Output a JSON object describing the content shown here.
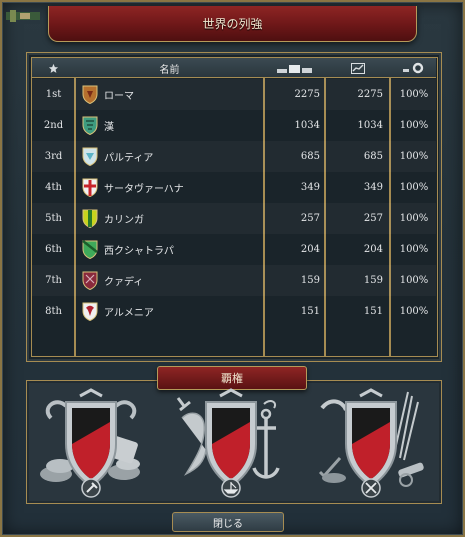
{
  "window": {
    "title": "世界の列強"
  },
  "table": {
    "headers": {
      "rank_icon": "star-icon",
      "name": "名前",
      "score_icon": "stacked-bars-icon",
      "trend_icon": "line-chart-icon",
      "percent_icon": "gear-icon"
    },
    "rows": [
      {
        "rank": "1st",
        "name": "ローマ",
        "score": "2275",
        "score2": "2275",
        "percent": "100%",
        "shield": {
          "base": "#b5702e",
          "accent": "#7a2b16"
        }
      },
      {
        "rank": "2nd",
        "name": "漢",
        "score": "1034",
        "score2": "1034",
        "percent": "100%",
        "shield": {
          "base": "#3e9c7f",
          "accent": "#1e4e3e"
        }
      },
      {
        "rank": "3rd",
        "name": "パルティア",
        "score": "685",
        "score2": "685",
        "percent": "100%",
        "shield": {
          "base": "#cfe4ea",
          "accent": "#5bb3c7"
        }
      },
      {
        "rank": "4th",
        "name": "サータヴァーハナ",
        "score": "349",
        "score2": "349",
        "percent": "100%",
        "shield": {
          "base": "#f2f2f2",
          "accent": "#c8252a"
        }
      },
      {
        "rank": "5th",
        "name": "カリンガ",
        "score": "257",
        "score2": "257",
        "percent": "100%",
        "shield": {
          "base": "#c8d41e",
          "accent": "#2a7a2a"
        }
      },
      {
        "rank": "6th",
        "name": "西クシャトラパ",
        "score": "204",
        "score2": "204",
        "percent": "100%",
        "shield": {
          "base": "#3faa5a",
          "accent": "#1b5e2a"
        }
      },
      {
        "rank": "7th",
        "name": "クァディ",
        "score": "159",
        "score2": "159",
        "percent": "100%",
        "shield": {
          "base": "#8a2a3c",
          "accent": "#d8b0b8"
        }
      },
      {
        "rank": "8th",
        "name": "アルメニア",
        "score": "151",
        "score2": "151",
        "percent": "100%",
        "shield": {
          "base": "#f0f0f0",
          "accent": "#b02330"
        }
      }
    ]
  },
  "hegemony": {
    "title": "覇権",
    "emblems": [
      {
        "name": "economic-hegemony",
        "icon": "coins-and-scroll-icon",
        "badge": "hammer-icon",
        "colors": {
          "top": "#1a1a1a",
          "bottom": "#c0202a"
        }
      },
      {
        "name": "naval-hegemony",
        "icon": "horse-and-anchor-icon",
        "badge": "ship-icon",
        "colors": {
          "top": "#1a1a1a",
          "bottom": "#c0202a"
        }
      },
      {
        "name": "military-hegemony",
        "icon": "weapons-and-cannon-icon",
        "badge": "crossed-swords-icon",
        "colors": {
          "top": "#1a1a1a",
          "bottom": "#c0202a"
        }
      }
    ]
  },
  "footer": {
    "close_label": "閉じる"
  }
}
